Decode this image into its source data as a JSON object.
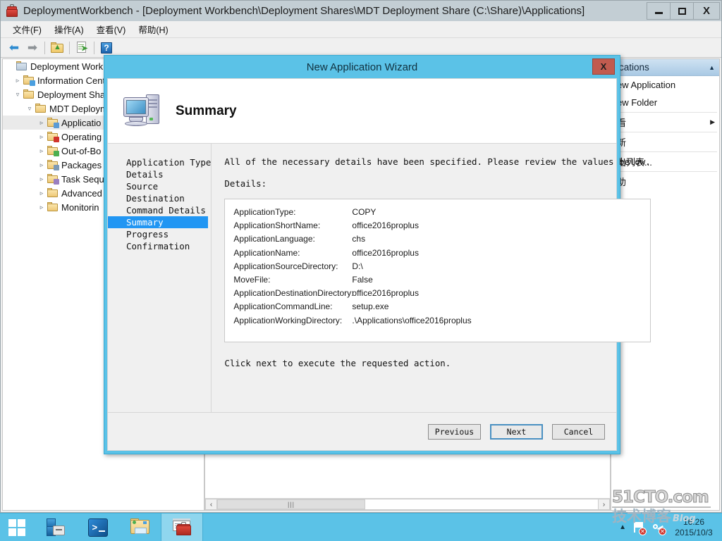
{
  "window": {
    "title": "DeploymentWorkbench - [Deployment Workbench\\Deployment Shares\\MDT Deployment Share (C:\\Share)\\Applications]",
    "app_icon": "toolbox-icon",
    "controls": {
      "minimize": "minimize-icon",
      "restore": "restore-icon",
      "close": "X"
    }
  },
  "menubar": {
    "items": [
      {
        "label": "文件(F)"
      },
      {
        "label": "操作(A)"
      },
      {
        "label": "查看(V)"
      },
      {
        "label": "帮助(H)"
      }
    ]
  },
  "toolbar": {
    "items": [
      {
        "name": "back-arrow-icon",
        "glyph": "⬅"
      },
      {
        "name": "forward-arrow-icon",
        "glyph": "➡"
      },
      {
        "name": "up-folder-icon",
        "glyph": "folder"
      },
      {
        "name": "export-list-icon",
        "glyph": "document"
      },
      {
        "name": "help-icon",
        "glyph": "?"
      }
    ]
  },
  "tree": {
    "nodes": [
      {
        "label": "Deployment Workb",
        "indent": 0,
        "expander": "",
        "icon": "console-root-icon",
        "selected": false
      },
      {
        "label": "Information Cent",
        "indent": 1,
        "expander": "▹",
        "icon": "information-center-icon",
        "selected": false
      },
      {
        "label": "Deployment Sha",
        "indent": 1,
        "expander": "▿",
        "icon": "deployment-shares-icon",
        "selected": false
      },
      {
        "label": "MDT Deploym",
        "indent": 2,
        "expander": "▿",
        "icon": "share-icon",
        "selected": false
      },
      {
        "label": "Applicatio",
        "indent": 3,
        "expander": "▹",
        "icon": "applications-icon",
        "selected": true
      },
      {
        "label": "Operating",
        "indent": 3,
        "expander": "▹",
        "icon": "operating-systems-icon",
        "selected": false
      },
      {
        "label": "Out-of-Bo",
        "indent": 3,
        "expander": "▹",
        "icon": "out-of-box-drivers-icon",
        "selected": false
      },
      {
        "label": "Packages",
        "indent": 3,
        "expander": "▹",
        "icon": "packages-icon",
        "selected": false
      },
      {
        "label": "Task Sequ",
        "indent": 3,
        "expander": "▹",
        "icon": "task-sequences-icon",
        "selected": false
      },
      {
        "label": "Advanced",
        "indent": 3,
        "expander": "▹",
        "icon": "advanced-configuration-icon",
        "selected": false
      },
      {
        "label": "Monitorin",
        "indent": 3,
        "expander": "▹",
        "icon": "monitoring-icon",
        "selected": false
      }
    ]
  },
  "list_pane": {
    "columns": [
      "",
      ""
    ],
    "rows": [],
    "scrollbar": {
      "left_arrow": "‹",
      "right_arrow": "›",
      "thumb_grip": "|||"
    }
  },
  "actions_pane": {
    "header": "ications",
    "collapse_icon": "chevron-up-icon",
    "items": [
      {
        "label": "ew Application",
        "submenu": false
      },
      {
        "label": "ew Folder",
        "submenu": false
      },
      {
        "label": "看",
        "submenu": true
      },
      {
        "label": "新",
        "submenu": false
      },
      {
        "label": "出列表...",
        "submenu": false
      },
      {
        "label": "助",
        "submenu": false
      }
    ]
  },
  "wizard": {
    "title": "New Application Wizard",
    "close_label": "X",
    "header": {
      "icon": "computer-icon",
      "heading": "Summary"
    },
    "steps": [
      {
        "label": "Application Type",
        "active": false
      },
      {
        "label": "Details",
        "active": false
      },
      {
        "label": "Source",
        "active": false
      },
      {
        "label": "Destination",
        "active": false
      },
      {
        "label": "Command Details",
        "active": false
      },
      {
        "label": "Summary",
        "active": true
      },
      {
        "label": "Progress",
        "active": false
      },
      {
        "label": "Confirmation",
        "active": false
      }
    ],
    "intro": "All of the necessary details have been specified.  Please review the values below.",
    "details_label": "Details:",
    "details": [
      {
        "key": "ApplicationType:",
        "value": "COPY"
      },
      {
        "key": "ApplicationShortName:",
        "value": "office2016proplus"
      },
      {
        "key": "ApplicationLanguage:",
        "value": "chs"
      },
      {
        "key": "ApplicationName:",
        "value": "office2016proplus"
      },
      {
        "key": "ApplicationSourceDirectory:",
        "value": "D:\\"
      },
      {
        "key": "MoveFile:",
        "value": "False"
      },
      {
        "key": "ApplicationDestinationDirectory:",
        "value": "office2016proplus"
      },
      {
        "key": "ApplicationCommandLine:",
        "value": "setup.exe"
      },
      {
        "key": "ApplicationWorkingDirectory:",
        "value": ".\\Applications\\office2016proplus"
      }
    ],
    "footer_note": "Click next to execute the requested action.",
    "buttons": [
      {
        "label": "Previous",
        "focused": false
      },
      {
        "label": "Next",
        "focused": true
      },
      {
        "label": "Cancel",
        "focused": false
      }
    ]
  },
  "taskbar": {
    "start_label": "start-button",
    "apps": [
      {
        "name": "server-manager-icon",
        "active": false
      },
      {
        "name": "powershell-icon",
        "active": false
      },
      {
        "name": "file-explorer-icon",
        "active": false
      },
      {
        "name": "deployment-workbench-icon",
        "active": true
      }
    ],
    "tray": {
      "chevron": "▲",
      "icons": [
        "flag-notification-icon",
        "network-icon"
      ],
      "clock_time": "16:26",
      "clock_date": "2015/10/3"
    }
  },
  "watermark": {
    "line1": "51CTO.com",
    "line2": "技术博客",
    "line3": "Blog"
  },
  "colors": {
    "accent_cyan": "#5BC2E7",
    "titlebar": "#C3CED4",
    "selection_blue": "#2196F3",
    "close_red": "#C15B4F"
  }
}
